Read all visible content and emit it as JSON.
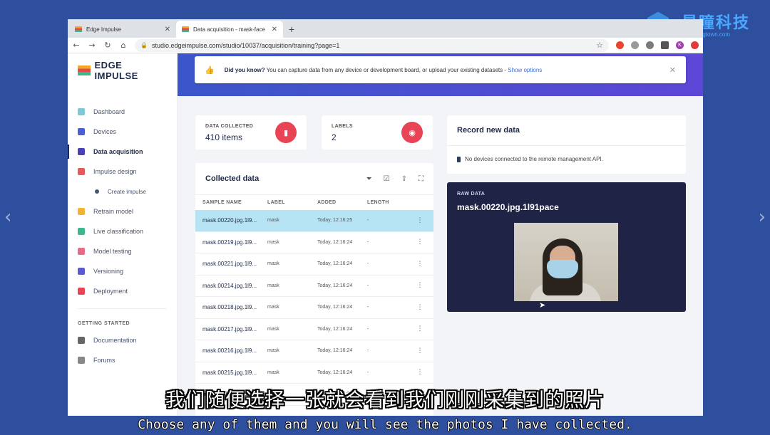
{
  "watermark": {
    "brand": "星瞳科技",
    "url": "www.singtown.com"
  },
  "browser": {
    "tabs": [
      {
        "title": "Edge Impulse",
        "active": false
      },
      {
        "title": "Data acquisition - mask-face",
        "active": true
      }
    ],
    "url": "studio.edgeimpulse.com/studio/10037/acquisition/training?page=1",
    "profile_initial": "K"
  },
  "sidebar": {
    "brand": "EDGE IMPULSE",
    "items": [
      {
        "label": "Dashboard",
        "color": "#7fc6d9"
      },
      {
        "label": "Devices",
        "color": "#4b5fd0"
      },
      {
        "label": "Data acquisition",
        "color": "#4a3fb6",
        "active": true
      },
      {
        "label": "Impulse design",
        "color": "#e55a5a"
      },
      {
        "label": "Create impulse",
        "sub": true
      },
      {
        "label": "Retrain model",
        "color": "#f2b233"
      },
      {
        "label": "Live classification",
        "color": "#3db88b"
      },
      {
        "label": "Model testing",
        "color": "#e86b86"
      },
      {
        "label": "Versioning",
        "color": "#5a5ad6"
      },
      {
        "label": "Deployment",
        "color": "#e84455"
      }
    ],
    "section_label": "GETTING STARTED",
    "footer_items": [
      {
        "label": "Documentation",
        "color": "#666"
      },
      {
        "label": "Forums",
        "color": "#888"
      }
    ]
  },
  "banner": {
    "bold": "Did you know?",
    "text": " You can capture data from any device or development board, or upload your existing datasets - ",
    "link": "Show options"
  },
  "stats": {
    "collected_label": "DATA COLLECTED",
    "collected_value": "410 items",
    "labels_label": "LABELS",
    "labels_value": "2"
  },
  "record": {
    "title": "Record new data",
    "no_devices": "No devices connected to the remote management API."
  },
  "collected": {
    "title": "Collected data",
    "columns": [
      "SAMPLE NAME",
      "LABEL",
      "ADDED",
      "LENGTH"
    ],
    "rows": [
      {
        "name": "mask.00220.jpg.1l9...",
        "label": "mask",
        "added": "Today, 12:16:25",
        "length": "-",
        "selected": true
      },
      {
        "name": "mask.00219.jpg.1l9...",
        "label": "mask",
        "added": "Today, 12:16:24",
        "length": "-"
      },
      {
        "name": "mask.00221.jpg.1l9...",
        "label": "mask",
        "added": "Today, 12:16:24",
        "length": "-"
      },
      {
        "name": "mask.00214.jpg.1l9...",
        "label": "mask",
        "added": "Today, 12:16:24",
        "length": "-"
      },
      {
        "name": "mask.00218.jpg.1l9...",
        "label": "mask",
        "added": "Today, 12:16:24",
        "length": "-"
      },
      {
        "name": "mask.00217.jpg.1l9...",
        "label": "mask",
        "added": "Today, 12:16:24",
        "length": "-"
      },
      {
        "name": "mask.00216.jpg.1l9...",
        "label": "mask",
        "added": "Today, 12:16:24",
        "length": "-"
      },
      {
        "name": "mask.00215.jpg.1l9...",
        "label": "mask",
        "added": "Today, 12:16:24",
        "length": "-"
      },
      {
        "name": "mask.00213.jpg.1l9...",
        "label": "mask",
        "added": "Today, 12:16:23",
        "length": "-"
      }
    ]
  },
  "raw": {
    "label": "RAW DATA",
    "name": "mask.00220.jpg.1l91pace"
  },
  "subtitles": {
    "cn": "我们随便选择一张就会看到我们刚刚采集到的照片",
    "en": "Choose any of them and you will see the photos I have collected."
  }
}
